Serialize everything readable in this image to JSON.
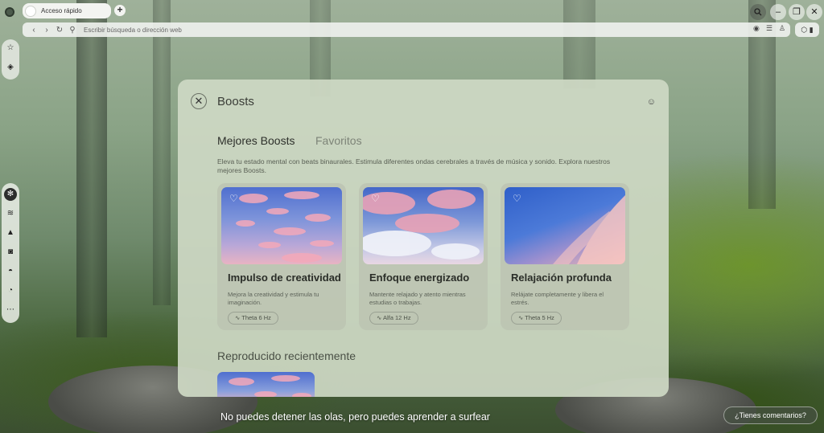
{
  "browser": {
    "tab_label": "Acceso rápido",
    "new_tab_symbol": "+",
    "address_placeholder": "Escribir búsqueda o dirección web",
    "window_buttons": [
      "search-icon",
      "minimize-icon",
      "restore-icon",
      "close-icon"
    ]
  },
  "rail": {
    "top_icons": [
      "star-icon",
      "compass-icon"
    ],
    "icons": [
      "boost-icon",
      "waves-icon",
      "mountain-icon",
      "instagram-icon",
      "messenger-icon",
      "whatsapp-icon",
      "more-icon"
    ]
  },
  "modal": {
    "title": "Boosts",
    "tabs": [
      "Mejores Boosts",
      "Favoritos"
    ],
    "description": "Eleva tu estado mental con beats binaurales. Estimula diferentes ondas cerebrales a través de música y sonido. Explora nuestros mejores Boosts.",
    "cards": [
      {
        "title": "Impulso de creatividad",
        "description": "Mejora la creatividad y estimula tu imaginación.",
        "wave": "Theta 6 Hz"
      },
      {
        "title": "Enfoque energizado",
        "description": "Mantente relajado y atento mientras estudias o trabajas.",
        "wave": "Alfa 12 Hz"
      },
      {
        "title": "Relajación profunda",
        "description": "Relájate completamente y libera el estrés.",
        "wave": "Theta 5 Hz"
      }
    ],
    "recent_label": "Reproducido recientemente"
  },
  "quote": "No puedes detener las olas, pero puedes aprender a surfear",
  "feedback_label": "¿Tienes comentarios?",
  "colors": {
    "sky_blue": "#5a7fd6",
    "cloud_pink": "#f0a6b6"
  }
}
